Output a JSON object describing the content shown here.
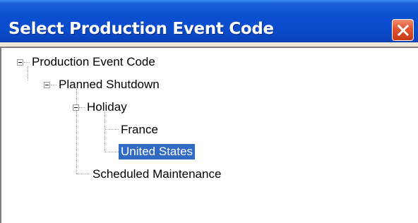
{
  "window": {
    "title": "Select Production Event Code",
    "close_icon": "close-icon"
  },
  "tree": {
    "root": {
      "label": "Production Event Code",
      "expanded": true,
      "children": {
        "planned_shutdown": {
          "label": "Planned Shutdown",
          "expanded": true,
          "children": {
            "holiday": {
              "label": "Holiday",
              "expanded": true,
              "children": {
                "france": {
                  "label": "France"
                },
                "united_states": {
                  "label": "United States",
                  "selected": true
                }
              }
            },
            "scheduled_maintenance": {
              "label": "Scheduled Maintenance"
            }
          }
        }
      }
    }
  },
  "colors": {
    "title_bar": "#0a4ccb",
    "selection": "#316ac5",
    "close_button": "#e0542e"
  }
}
